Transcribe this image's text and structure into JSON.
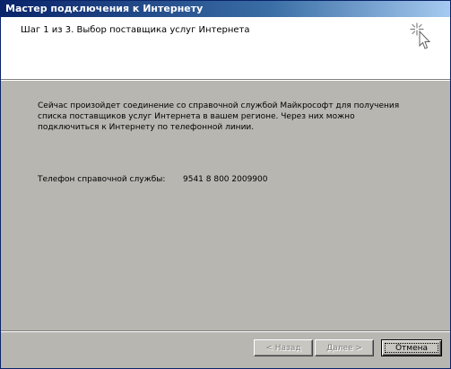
{
  "window": {
    "title": "Мастер подключения к Интернету"
  },
  "header": {
    "step_title": "Шаг 1 из 3. Выбор поставщика услуг Интернета",
    "icon": "wizard-wand-icon"
  },
  "content": {
    "description": "Сейчас произойдет соединение со справочной службой Майкрософт для получения списка поставщиков услуг Интернета в вашем регионе. Через них можно подключиться к Интернету по телефонной линии.",
    "phone_label": "Телефон справочной службы:",
    "phone_value": "9541 8 800 2009900"
  },
  "buttons": {
    "back": "< Назад",
    "next": "Далее >",
    "cancel": "Отмена"
  },
  "colors": {
    "titlebar_start": "#0a246a",
    "titlebar_end": "#a6caf0",
    "body_bg": "#b8b6b0",
    "header_bg": "#ffffff"
  }
}
